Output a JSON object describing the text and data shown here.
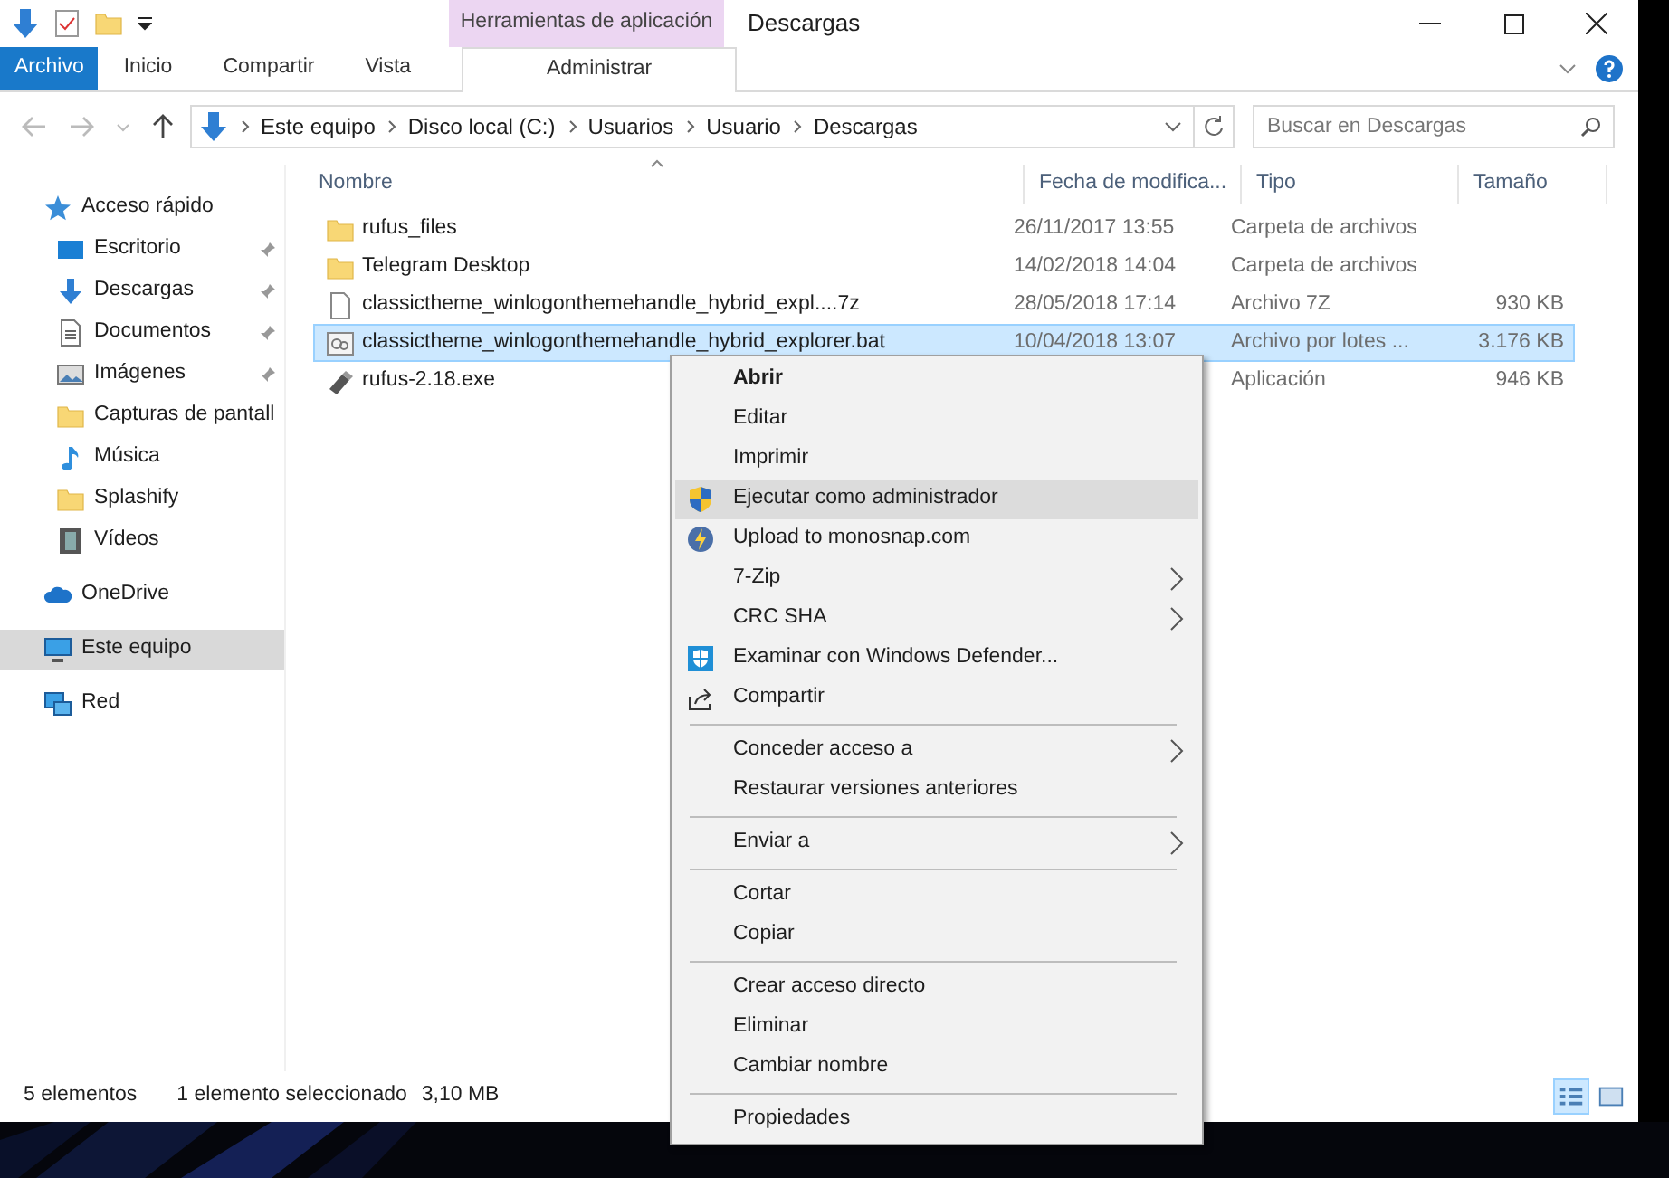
{
  "window": {
    "title": "Descargas",
    "context_header": "Herramientas de aplicación"
  },
  "ribbon_tabs": [
    {
      "label": "Archivo",
      "kind": "file"
    },
    {
      "label": "Inicio",
      "kind": "plain"
    },
    {
      "label": "Compartir",
      "kind": "plain"
    },
    {
      "label": "Vista",
      "kind": "plain"
    },
    {
      "label": "Administrar",
      "kind": "contextual"
    }
  ],
  "address": {
    "path": [
      "Este equipo",
      "Disco local (C:)",
      "Usuarios",
      "Usuario",
      "Descargas"
    ]
  },
  "search": {
    "placeholder": "Buscar en Descargas"
  },
  "sidebar": {
    "items": [
      {
        "label": "Acceso rápido",
        "kind": "star",
        "selected": false,
        "children": [
          {
            "label": "Escritorio",
            "kind": "desktop",
            "pinned": true,
            "selected": false
          },
          {
            "label": "Descargas",
            "kind": "download",
            "pinned": true,
            "selected": false
          },
          {
            "label": "Documentos",
            "kind": "docs",
            "pinned": true,
            "selected": false
          },
          {
            "label": "Imágenes",
            "kind": "images",
            "pinned": true,
            "selected": false
          },
          {
            "label": "Capturas de pantall",
            "kind": "folder",
            "pinned": false,
            "selected": false
          },
          {
            "label": "Música",
            "kind": "music",
            "pinned": false,
            "selected": false
          },
          {
            "label": "Splashify",
            "kind": "folder",
            "pinned": false,
            "selected": false
          },
          {
            "label": "Vídeos",
            "kind": "video",
            "pinned": false,
            "selected": false
          }
        ]
      },
      {
        "label": "OneDrive",
        "kind": "cloud",
        "selected": false
      },
      {
        "label": "Este equipo",
        "kind": "pc",
        "selected": true
      },
      {
        "label": "Red",
        "kind": "network",
        "selected": false
      }
    ]
  },
  "table": {
    "columns": [
      "Nombre",
      "Fecha de modifica...",
      "Tipo",
      "Tamaño"
    ],
    "rows": [
      {
        "name": "rufus_files",
        "date": "26/11/2017 13:55",
        "type": "Carpeta de archivos",
        "size": "",
        "kind": "folder",
        "selected": false
      },
      {
        "name": "Telegram Desktop",
        "date": "14/02/2018 14:04",
        "type": "Carpeta de archivos",
        "size": "",
        "kind": "folder",
        "selected": false
      },
      {
        "name": "classictheme_winlogonthemehandle_hybrid_expl....7z",
        "date": "28/05/2018 17:14",
        "type": "Archivo 7Z",
        "size": "930 KB",
        "kind": "file",
        "selected": false
      },
      {
        "name": "classictheme_winlogonthemehandle_hybrid_explorer.bat",
        "date": "10/04/2018 13:07",
        "type": "Archivo por lotes ...",
        "size": "3.176 KB",
        "kind": "bat",
        "selected": true
      },
      {
        "name": "rufus-2.18.exe",
        "date": "",
        "type": "Aplicación",
        "size": "946 KB",
        "kind": "exe",
        "selected": false
      }
    ]
  },
  "context_menu": {
    "items": [
      {
        "kind": "plain",
        "label": "Abrir",
        "default": true,
        "selected": false
      },
      {
        "kind": "plain",
        "label": "Editar",
        "default": false,
        "selected": false
      },
      {
        "kind": "plain",
        "label": "Imprimir",
        "default": false,
        "selected": false
      },
      {
        "kind": "shield",
        "label": "Ejecutar como administrador",
        "default": false,
        "selected": true
      },
      {
        "kind": "bolt",
        "label": "Upload to monosnap.com",
        "default": false,
        "selected": false
      },
      {
        "kind": "submenu",
        "label": "7-Zip",
        "default": false,
        "selected": false
      },
      {
        "kind": "submenu",
        "label": "CRC SHA",
        "default": false,
        "selected": false
      },
      {
        "kind": "defender",
        "label": "Examinar con Windows Defender...",
        "default": false,
        "selected": false
      },
      {
        "kind": "share",
        "label": "Compartir",
        "default": false,
        "selected": false
      },
      {
        "kind": "separator"
      },
      {
        "kind": "submenu",
        "label": "Conceder acceso a",
        "default": false,
        "selected": false
      },
      {
        "kind": "plain",
        "label": "Restaurar versiones anteriores",
        "default": false,
        "selected": false
      },
      {
        "kind": "separator"
      },
      {
        "kind": "submenu",
        "label": "Enviar a",
        "default": false,
        "selected": false
      },
      {
        "kind": "separator"
      },
      {
        "kind": "plain",
        "label": "Cortar",
        "default": false,
        "selected": false
      },
      {
        "kind": "plain",
        "label": "Copiar",
        "default": false,
        "selected": false
      },
      {
        "kind": "separator"
      },
      {
        "kind": "plain",
        "label": "Crear acceso directo",
        "default": false,
        "selected": false
      },
      {
        "kind": "plain",
        "label": "Eliminar",
        "default": false,
        "selected": false
      },
      {
        "kind": "plain",
        "label": "Cambiar nombre",
        "default": false,
        "selected": false
      },
      {
        "kind": "separator"
      },
      {
        "kind": "plain",
        "label": "Propiedades",
        "default": false,
        "selected": false
      }
    ]
  },
  "status_bar": {
    "count": "5 elementos",
    "selection": "1 elemento seleccionado",
    "size": "3,10 MB",
    "views": [
      {
        "kind": "details",
        "selected": true
      },
      {
        "kind": "large",
        "selected": false
      }
    ]
  }
}
